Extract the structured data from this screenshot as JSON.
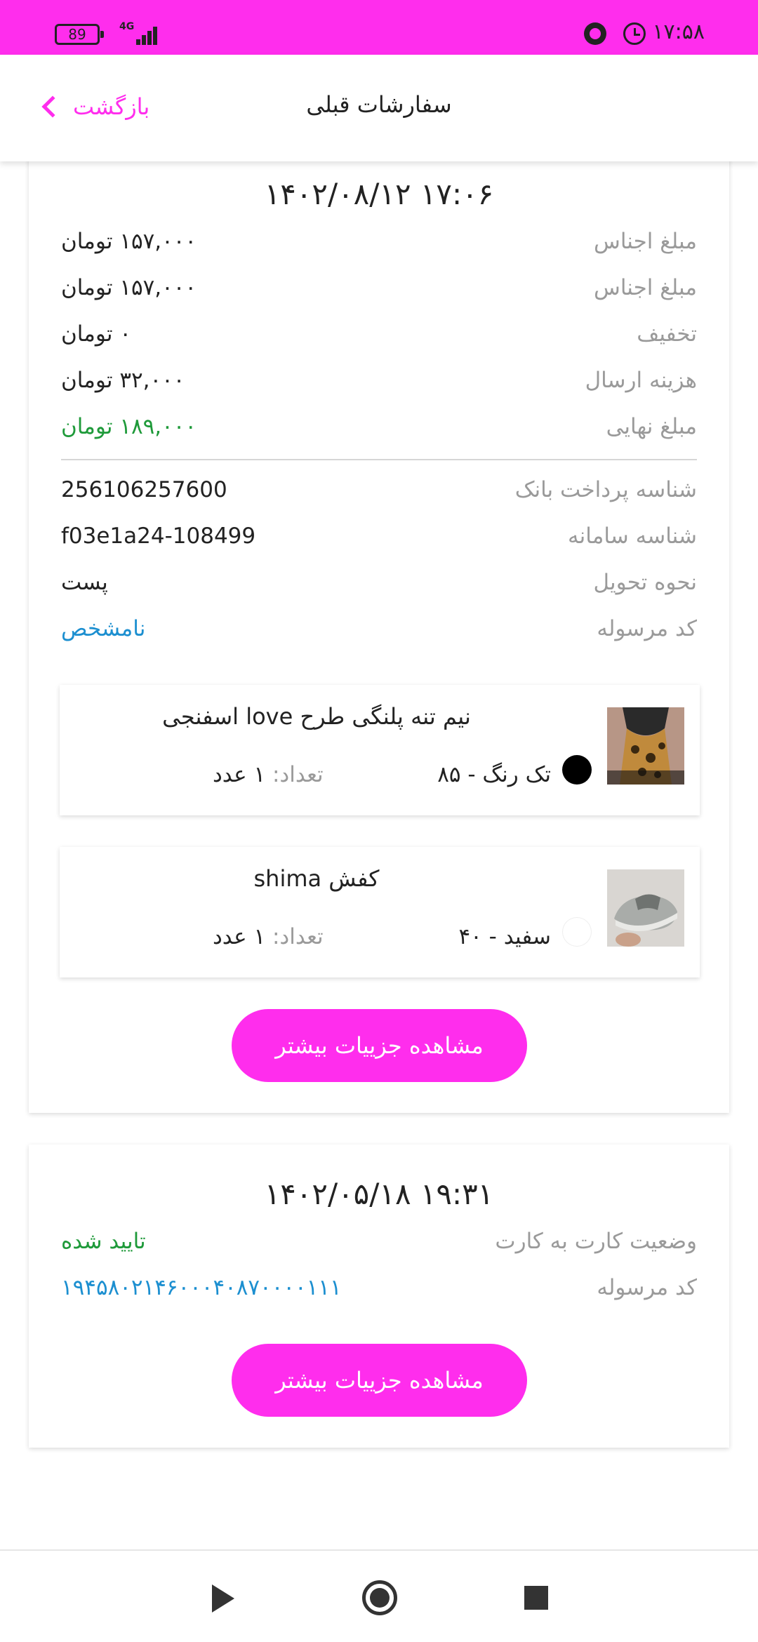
{
  "status_bar": {
    "battery": "89",
    "network": "4G",
    "time": "۱۷:۵۸",
    "icons": [
      "battery-icon",
      "signal-icon",
      "alarm-icon",
      "vpn-icon"
    ]
  },
  "header": {
    "title": "سفارشات قبلی",
    "back_label": "بازگشت",
    "back_icon": "chevron-left-icon"
  },
  "colors": {
    "accent": "#ff2ded",
    "success": "#1f9a3a",
    "link": "#1c8fd0",
    "label": "#9a9a9a"
  },
  "orders": [
    {
      "date": "۱۴۰۲/۰۸/۱۲ ۱۷:۰۶",
      "rows": [
        {
          "label": "مبلغ اجناس",
          "value": "۱۵۷,۰۰۰ تومان"
        },
        {
          "label": "مبلغ اجناس",
          "value": "۱۵۷,۰۰۰ تومان"
        },
        {
          "label": "تخفیف",
          "value": "۰ تومان"
        },
        {
          "label": "هزینه ارسال",
          "value": "۳۲,۰۰۰ تومان"
        },
        {
          "label": "مبلغ نهایی",
          "value": "۱۸۹,۰۰۰ تومان"
        }
      ],
      "rows2": [
        {
          "label": "شناسه پرداخت بانک",
          "value": "256106257600"
        },
        {
          "label": "شناسه سامانه",
          "value": "f03e1a24-108499"
        },
        {
          "label": "نحوه تحویل",
          "value": "پست"
        },
        {
          "label": "کد مرسوله",
          "value": "نامشخص"
        }
      ],
      "items": [
        {
          "name": "نیم تنه پلنگی طرح love اسفنجی",
          "variant": "تک رنگ  -  ۸۵",
          "qty_label": "تعداد:",
          "qty_value": " ۱ عدد",
          "swatch_color": "#000000"
        },
        {
          "name": "کفش shima",
          "variant": "سفید  -  ۴۰",
          "qty_label": "تعداد:",
          "qty_value": " ۱ عدد",
          "swatch_color": "#ffffff"
        }
      ],
      "details_button": "مشاهده جزییات بیشتر"
    },
    {
      "date": "۱۴۰۲/۰۵/۱۸ ۱۹:۳۱",
      "rows": [
        {
          "label": "وضعیت کارت به کارت",
          "value": "تایید شده"
        },
        {
          "label": "کد مرسوله",
          "value": "۱۹۴۵۸۰۲۱۴۶۰۰۰۴۰۸۷۰۰۰۰۱۱۱"
        }
      ],
      "details_button": "مشاهده جزییات بیشتر"
    }
  ],
  "nav_bar": {
    "icons": [
      "back-triangle-icon",
      "home-circle-icon",
      "recents-square-icon"
    ]
  }
}
